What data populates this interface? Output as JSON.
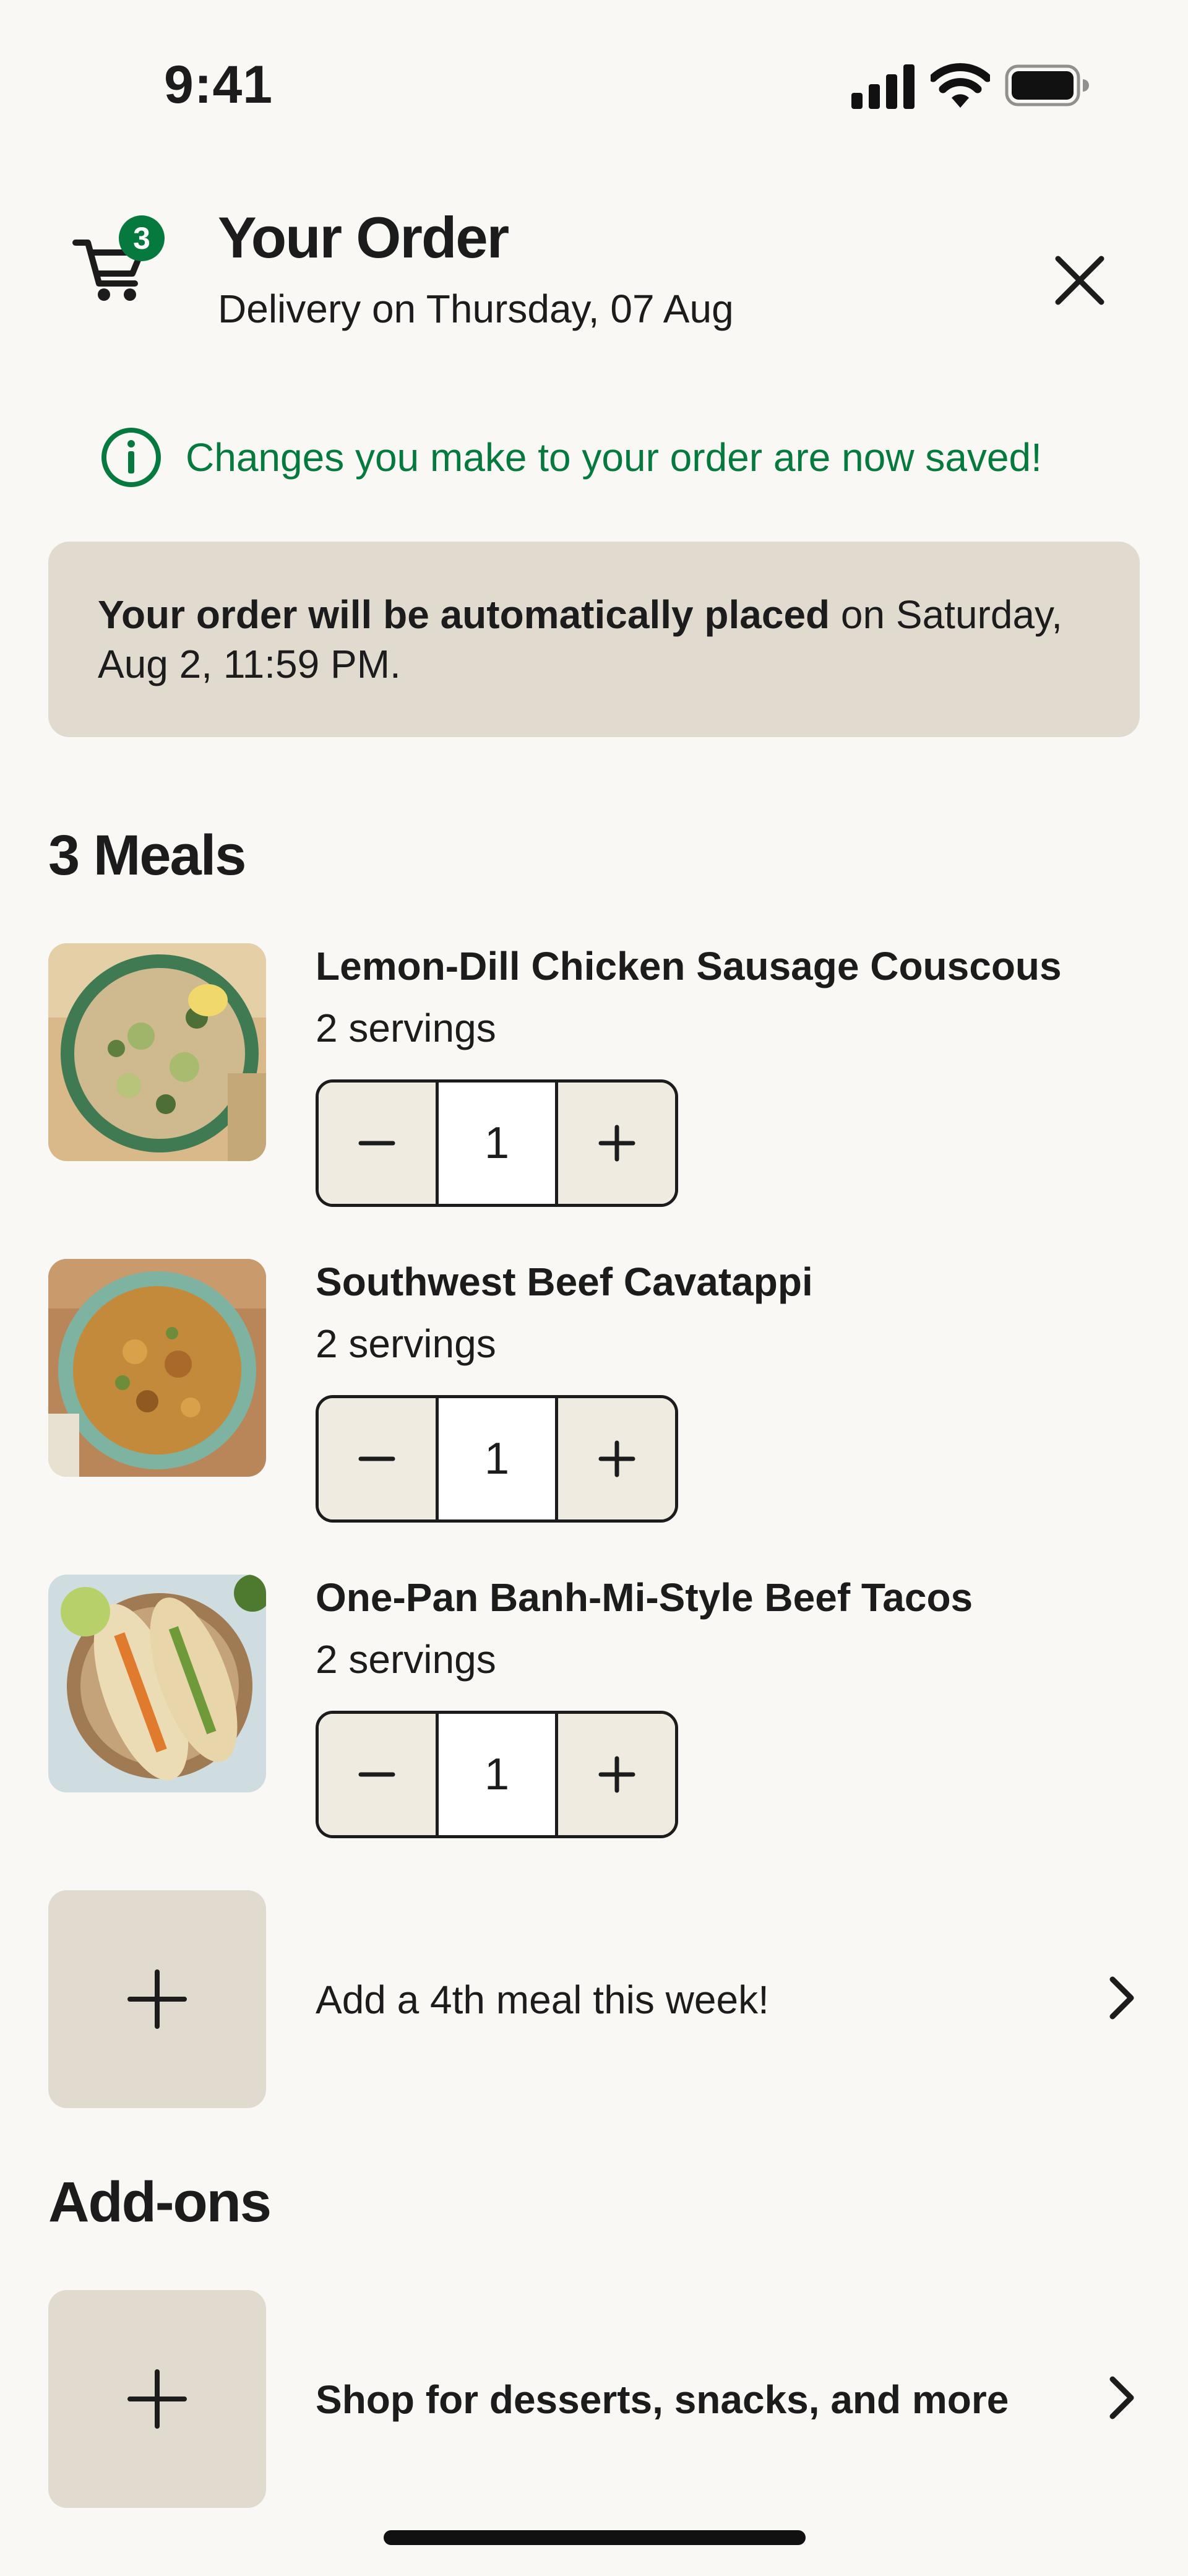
{
  "status_bar": {
    "time": "9:41"
  },
  "header": {
    "cart_count": "3",
    "title": "Your Order",
    "subtitle": "Delivery on Thursday, 07 Aug"
  },
  "notice": {
    "text": "Changes you make to your order are now saved!"
  },
  "banner": {
    "bold_text": "Your order will be automatically placed",
    "rest_text": " on Saturday, Aug 2, 11:59 PM."
  },
  "meals_section": {
    "title": "3 Meals",
    "items": [
      {
        "name": "Lemon-Dill Chicken Sausage Couscous",
        "servings": "2 servings",
        "quantity": "1",
        "decrement": "−",
        "increment": "+"
      },
      {
        "name": "Southwest Beef Cavatappi",
        "servings": "2 servings",
        "quantity": "1",
        "decrement": "−",
        "increment": "+"
      },
      {
        "name": "One-Pan Banh-Mi-Style Beef Tacos",
        "servings": "2 servings",
        "quantity": "1",
        "decrement": "−",
        "increment": "+"
      }
    ],
    "add_meal_text": "Add a 4th meal this week!"
  },
  "addons_section": {
    "title": "Add-ons",
    "shop_text": "Shop for desserts, snacks, and more"
  },
  "colors": {
    "accent_green": "#067a3e",
    "banner_bg": "#e1dbcf",
    "page_bg": "#f9f8f4"
  }
}
